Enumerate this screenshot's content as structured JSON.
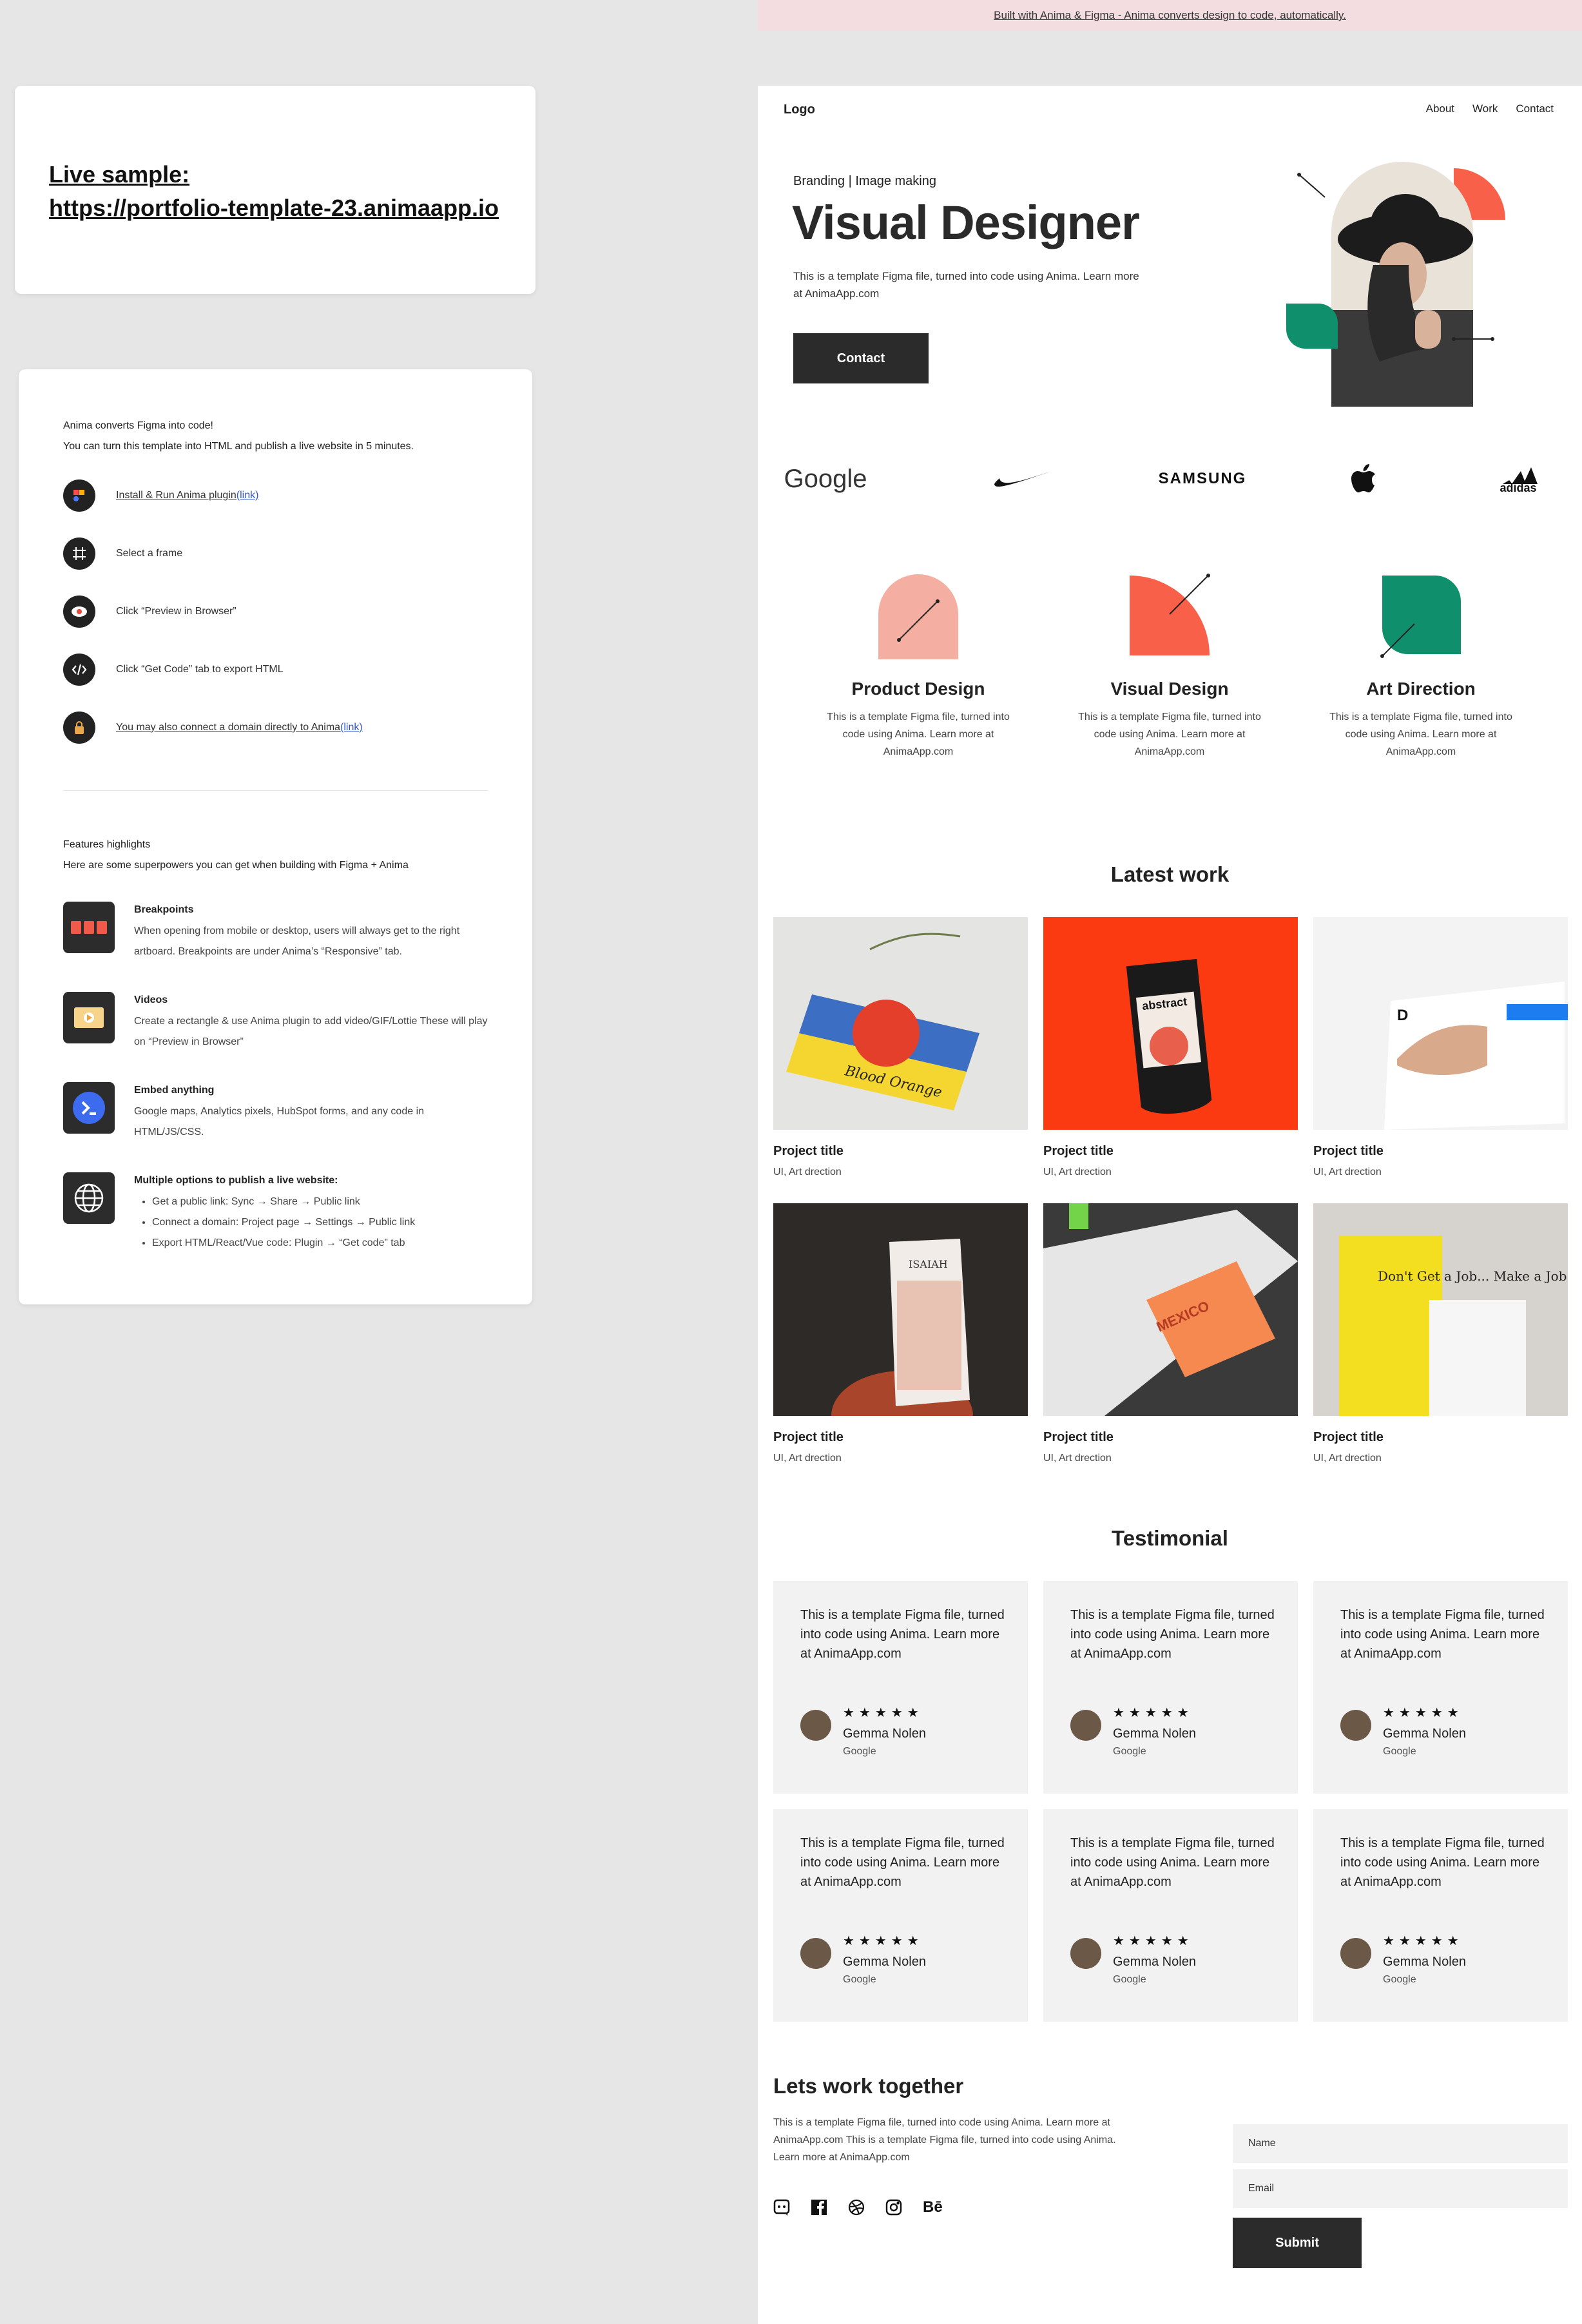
{
  "banner": {
    "text": "Built with Anima & Figma - Anima converts design to code, automatically."
  },
  "live_sample": {
    "label": "Live sample: ",
    "url": "https://portfolio-template-23.animaapp.io"
  },
  "guide": {
    "intro_line1": "Anima converts Figma into code!",
    "intro_line2": "You can turn this template into HTML and publish a live website in 5 minutes.",
    "steps": [
      {
        "label": "Install & Run Anima plugin ",
        "link": "(link)",
        "icon": "anima-logo-icon"
      },
      {
        "label": "Select a frame",
        "icon": "frame-icon"
      },
      {
        "label": "Click “Preview in Browser”",
        "icon": "eye-icon"
      },
      {
        "label": "Click “Get Code” tab to export HTML",
        "icon": "code-icon"
      },
      {
        "label": "You may also connect a domain directly to Anima ",
        "link": "(link)",
        "icon": "lock-icon"
      }
    ],
    "features_title": "Features highlights",
    "features_intro": "Here are some superpowers you can get when building with Figma + Anima",
    "features": [
      {
        "title": "Breakpoints",
        "desc": "When opening from mobile or desktop, users will always get to the right artboard. Breakpoints are under Anima’s “Responsive” tab.",
        "icon": "breakpoints-icon"
      },
      {
        "title": "Videos",
        "desc": "Create a rectangle & use Anima plugin to add video/GIF/Lottie These will play on “Preview in Browser”",
        "icon": "video-icon"
      },
      {
        "title": "Embed anything",
        "desc": "Google maps, Analytics pixels, HubSpot forms, and any code in HTML/JS/CSS.",
        "icon": "embed-icon"
      },
      {
        "title": "Multiple options to publish a live website:",
        "icon": "globe-icon",
        "bullets": [
          "Get a public link: Sync → Share → Public link",
          "Connect a domain: Project page → Settings → Public link",
          "Export HTML/React/Vue code: Plugin → “Get code” tab"
        ]
      }
    ]
  },
  "site": {
    "logo": "Logo",
    "nav": [
      "About",
      "Work",
      "Contact"
    ],
    "hero": {
      "eyebrow": "Branding | Image making",
      "title": "Visual Designer",
      "text": "This is a template Figma file, turned into code using Anima. Learn more at AnimaApp.com",
      "cta": "Contact"
    },
    "brands": [
      "Google",
      "nike-logo",
      "SAMSUNG",
      "apple-logo",
      "adidas"
    ],
    "services": [
      {
        "title": "Product Design",
        "desc": "This is a template Figma file, turned into code using Anima. Learn more at AnimaApp.com",
        "color": "#f4aea2"
      },
      {
        "title": "Visual Design",
        "desc": "This is a template Figma file, turned into code using Anima. Learn more at AnimaApp.com",
        "color": "#f9604a"
      },
      {
        "title": "Art Direction",
        "desc": "This is a template Figma file, turned into code using Anima. Learn more at AnimaApp.com",
        "color": "#108f6d"
      }
    ],
    "latest_work_title": "Latest work",
    "projects": [
      {
        "title": "Project title",
        "sub": "UI, Art drection",
        "img_text": "Blood Orange"
      },
      {
        "title": "Project title",
        "sub": "UI, Art drection",
        "img_text": "abstract"
      },
      {
        "title": "Project title",
        "sub": "UI, Art drection",
        "img_text": "D"
      },
      {
        "title": "Project title",
        "sub": "UI, Art drection",
        "img_text": "ISAIAH"
      },
      {
        "title": "Project title",
        "sub": "UI, Art drection",
        "img_text": "MEXICO"
      },
      {
        "title": "Project title",
        "sub": "UI, Art drection",
        "img_text": "Don't Get a Job... Make a Job"
      }
    ],
    "testimonial_title": "Testimonial",
    "testimonials": [
      {
        "quote": "This is a template Figma file, turned into code using Anima. Learn more at AnimaApp.com",
        "stars": "★★★★★",
        "name": "Gemma Nolen",
        "company": "Google"
      },
      {
        "quote": "This is a template Figma file, turned into code using Anima. Learn more at AnimaApp.com",
        "stars": "★★★★★",
        "name": "Gemma Nolen",
        "company": "Google"
      },
      {
        "quote": "This is a template Figma file, turned into code using Anima. Learn more at AnimaApp.com",
        "stars": "★★★★★",
        "name": "Gemma Nolen",
        "company": "Google"
      },
      {
        "quote": "This is a template Figma file, turned into code using Anima. Learn more at AnimaApp.com",
        "stars": "★★★★★",
        "name": "Gemma Nolen",
        "company": "Google"
      },
      {
        "quote": "This is a template Figma file, turned into code using Anima. Learn more at AnimaApp.com",
        "stars": "★★★★★",
        "name": "Gemma Nolen",
        "company": "Google"
      },
      {
        "quote": "This is a template Figma file, turned into code using Anima. Learn more at AnimaApp.com",
        "stars": "★★★★★",
        "name": "Gemma Nolen",
        "company": "Google"
      }
    ],
    "contact": {
      "title": "Lets work together",
      "text": "This is a template Figma file, turned into code using Anima. Learn more at AnimaApp.com This is a template Figma file, turned into code using Anima. Learn more at AnimaApp.com",
      "socials": [
        "discord-icon",
        "facebook-icon",
        "dribbble-icon",
        "instagram-icon",
        "behance-icon"
      ],
      "behance_label": "Bē",
      "name_placeholder": "Name",
      "email_placeholder": "Email",
      "submit": "Submit"
    },
    "colors": {
      "dark": "#2b2b2b",
      "coral": "#f9604a",
      "pink": "#f4aea2",
      "green": "#108f6d",
      "banner": "#f3dde0"
    }
  }
}
